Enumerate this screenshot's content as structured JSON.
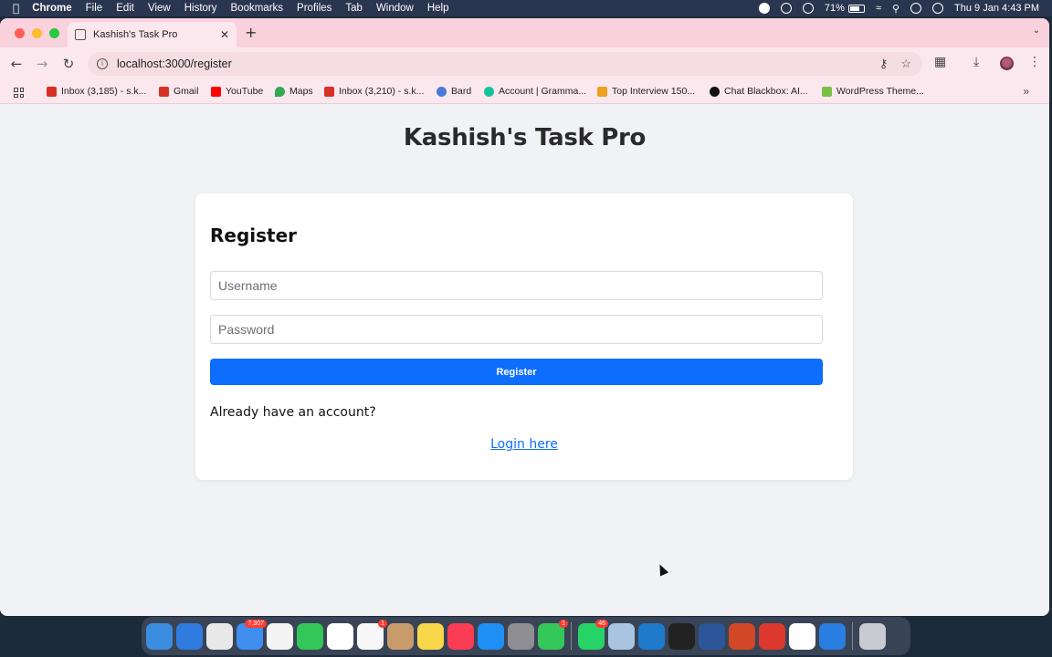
{
  "menubar": {
    "app": "Chrome",
    "items": [
      "File",
      "Edit",
      "View",
      "History",
      "Bookmarks",
      "Profiles",
      "Tab",
      "Window",
      "Help"
    ],
    "battery": "71%",
    "datetime": "Thu 9 Jan  4:43 PM"
  },
  "browser": {
    "tab_title": "Kashish's Task Pro",
    "url": "localhost:3000/register",
    "bookmarks": [
      {
        "label": "Inbox (3,185) - s.k...",
        "icon": "gmail-icon",
        "color": "#d93025"
      },
      {
        "label": "Gmail",
        "icon": "gmail-icon",
        "color": "#d93025"
      },
      {
        "label": "YouTube",
        "icon": "youtube-icon",
        "color": "#ff0000"
      },
      {
        "label": "Maps",
        "icon": "maps-icon",
        "color": "#34a853"
      },
      {
        "label": "Inbox (3,210) - s.k...",
        "icon": "gmail-icon",
        "color": "#d93025"
      },
      {
        "label": "Bard",
        "icon": "bard-icon",
        "color": "#4a7bd8"
      },
      {
        "label": "Account | Gramma...",
        "icon": "grammarly-icon",
        "color": "#15c39a"
      },
      {
        "label": "Top Interview 150...",
        "icon": "leetcode-icon",
        "color": "#f0a020"
      },
      {
        "label": "Chat Blackbox: AI...",
        "icon": "blackbox-icon",
        "color": "#111111"
      },
      {
        "label": "WordPress Theme...",
        "icon": "wordpress-icon",
        "color": "#7ac143"
      }
    ]
  },
  "page": {
    "app_title": "Kashish's Task Pro",
    "form_title": "Register",
    "username_placeholder": "Username",
    "password_placeholder": "Password",
    "submit_label": "Register",
    "prompt": "Already have an account?",
    "login_link": "Login here"
  },
  "colors": {
    "primary": "#0d6efd",
    "page_bg": "#f0f2f5",
    "tab_strip": "#f9d2dd"
  },
  "dock": {
    "apps": [
      {
        "name": "finder-icon",
        "color": "#3b8de0"
      },
      {
        "name": "safari-icon",
        "color": "#2f7be0"
      },
      {
        "name": "chrome-icon",
        "color": "#e8e8e8"
      },
      {
        "name": "mail-icon",
        "color": "#3f8ef0",
        "badge": "7,307"
      },
      {
        "name": "photos-icon",
        "color": "#f4f4f4"
      },
      {
        "name": "facetime-icon",
        "color": "#33c759"
      },
      {
        "name": "calendar-icon",
        "color": "#ffffff"
      },
      {
        "name": "reminders-icon",
        "color": "#f7f7f7",
        "badge": "1"
      },
      {
        "name": "contacts-icon",
        "color": "#c89c6a"
      },
      {
        "name": "notes-icon",
        "color": "#f8d74a"
      },
      {
        "name": "music-icon",
        "color": "#fa3d55"
      },
      {
        "name": "app-store-icon",
        "color": "#1f8ef5"
      },
      {
        "name": "system-settings-icon",
        "color": "#8e8e93"
      },
      {
        "name": "messages-icon",
        "color": "#34c759",
        "badge": "1"
      },
      {
        "name": "whatsapp-icon",
        "color": "#25d366",
        "badge": "46"
      },
      {
        "name": "preview-icon",
        "color": "#a8c4e0"
      },
      {
        "name": "vscode-icon",
        "color": "#1f7acc"
      },
      {
        "name": "terminal-icon",
        "color": "#222222"
      },
      {
        "name": "word-icon",
        "color": "#2b579a"
      },
      {
        "name": "powerpoint-icon",
        "color": "#d24726"
      },
      {
        "name": "redis-icon",
        "color": "#dc382d"
      },
      {
        "name": "mongodb-icon",
        "color": "#ffffff"
      },
      {
        "name": "xcode-instruments-icon",
        "color": "#2a7de1"
      },
      {
        "name": "trash-icon",
        "color": "#c8ccd2"
      }
    ]
  }
}
